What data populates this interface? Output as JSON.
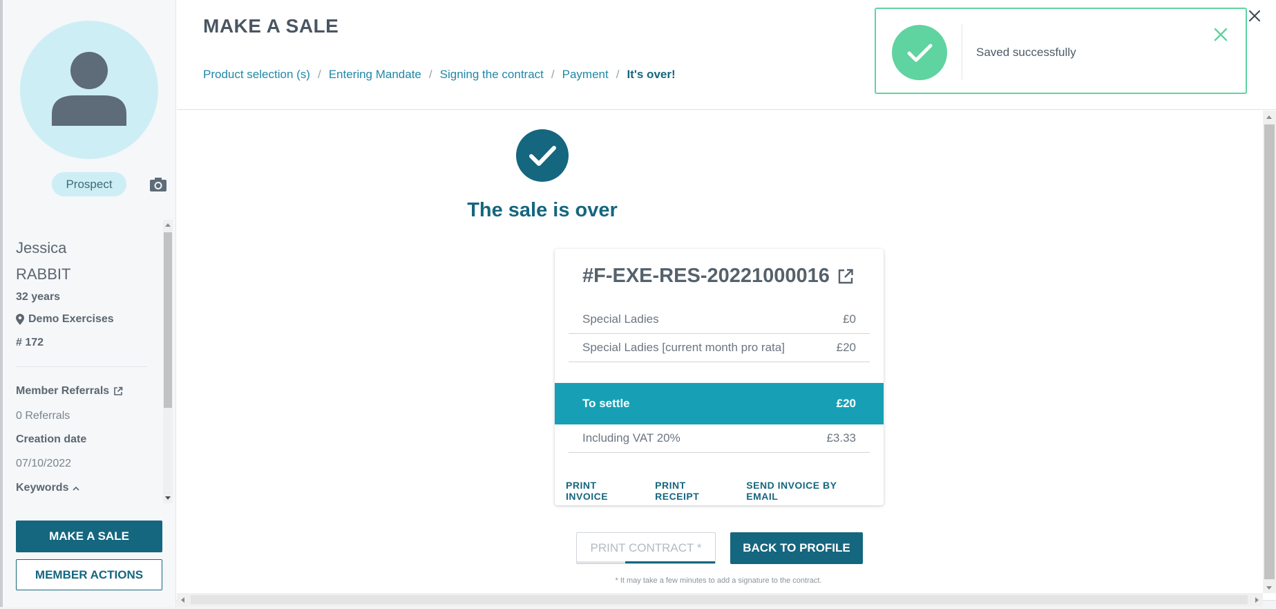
{
  "sidebar": {
    "badge": "Prospect",
    "first_name": "Jessica",
    "last_name": "RABBIT",
    "age": "32 years",
    "club": "Demo Exercises",
    "member_id": "# 172",
    "referrals_label": "Member Referrals",
    "referrals_value": "0 Referrals",
    "creation_label": "Creation date",
    "creation_value": "07/10/2022",
    "keywords_label": "Keywords",
    "make_sale_label": "MAKE A SALE",
    "member_actions_label": "MEMBER ACTIONS"
  },
  "header": {
    "title": "MAKE A SALE",
    "breadcrumb": [
      "Product selection (s)",
      "Entering Mandate",
      "Signing the contract",
      "Payment",
      "It's over!"
    ]
  },
  "toast": {
    "message": "Saved successfully",
    "color": "#5fd3a0"
  },
  "content": {
    "title": "The sale is over",
    "invoice_number": "#F-EXE-RES-20221000016",
    "lines": [
      {
        "label": "Special Ladies",
        "value": "£0"
      },
      {
        "label": "Special Ladies [current month pro rata]",
        "value": "£20"
      }
    ],
    "settle_label": "To settle",
    "settle_value": "£20",
    "vat_label": "Including VAT 20%",
    "vat_value": "£3.33",
    "actions": [
      "PRINT INVOICE",
      "PRINT RECEIPT",
      "SEND INVOICE BY EMAIL"
    ],
    "print_contract_label": "PRINT CONTRACT *",
    "back_label": "BACK TO PROFILE",
    "note": "* It may take a few minutes to add a signature to the contract."
  },
  "colors": {
    "primary": "#15667f",
    "accent": "#17a0b5",
    "success": "#5fd3a0"
  }
}
